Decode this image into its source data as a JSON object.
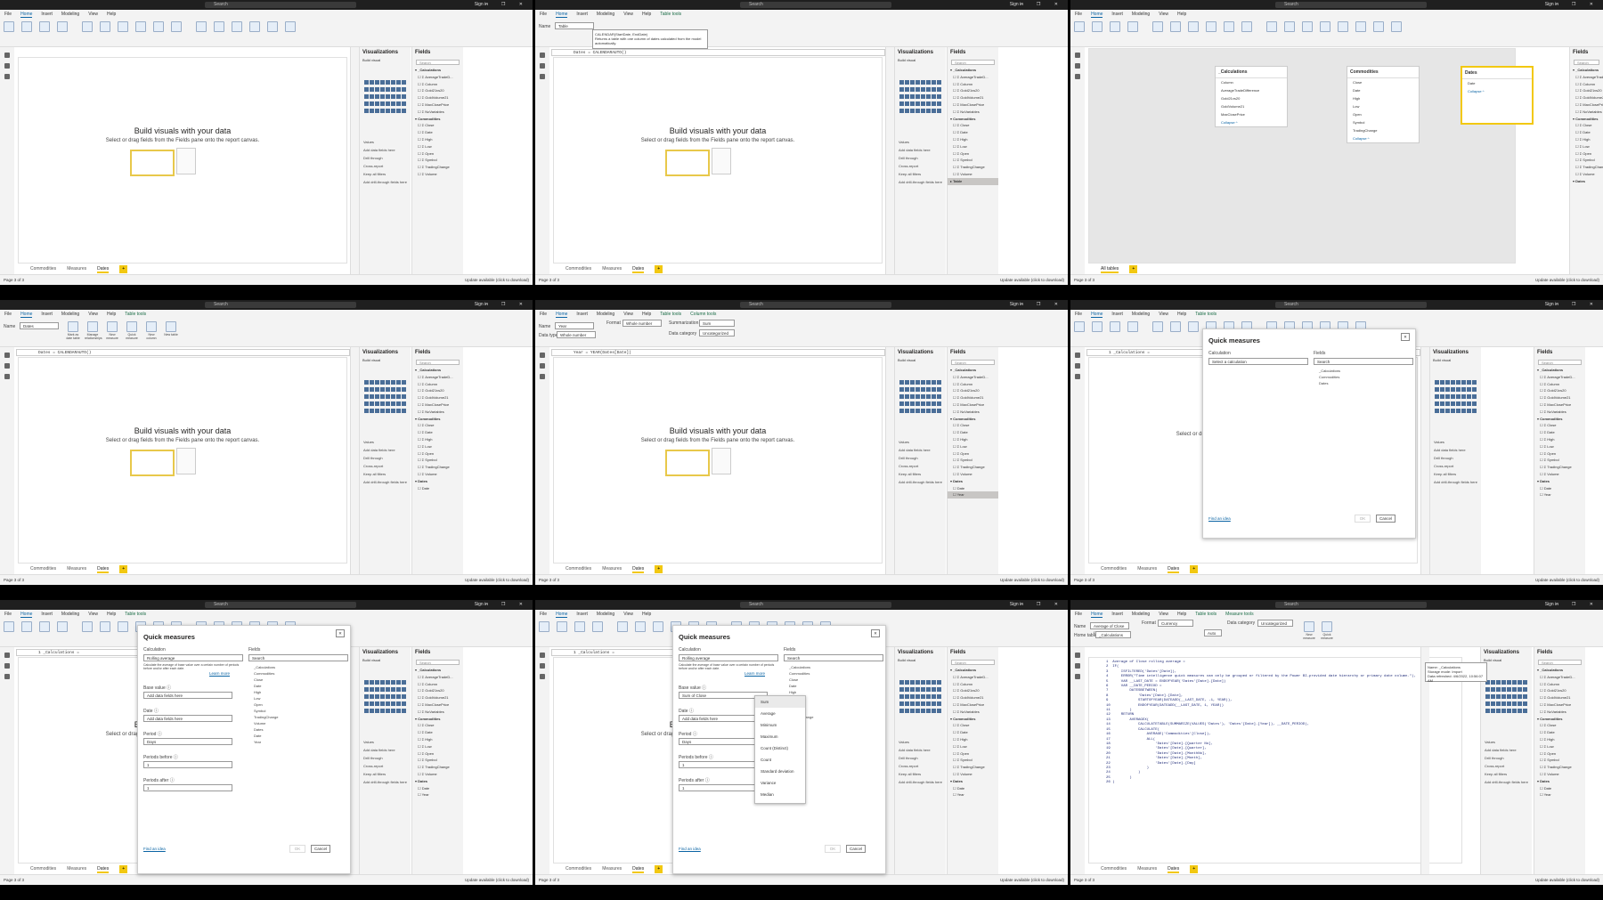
{
  "app": {
    "title": "3_date_and_time - Power BI Desktop",
    "search": "Search",
    "signin": "Sign in",
    "window_buttons": "– ❐ ✕"
  },
  "menus": {
    "base": [
      "File",
      "Home",
      "Insert",
      "Modeling",
      "View",
      "Help"
    ],
    "table_tools": "Table tools",
    "column_tools": "Column tools",
    "measure_tools": "Measure tools"
  },
  "canvas": {
    "title": "Build visuals with your data",
    "subtitle": "Select or drag fields from the Fields pane onto the report canvas."
  },
  "panels": {
    "visualizations": "Visualizations",
    "fields": "Fields",
    "filters": "Filters",
    "build_visual": "Build visual",
    "search": "Search",
    "values": "Values",
    "add_data_fields": "Add data fields here",
    "drill_through": "Drill through",
    "cross_report": "Cross-report",
    "keep_all_filters": "Keep all filters",
    "add_drill": "Add drill-through fields here"
  },
  "fields_list": [
    {
      "name": "_Calculations",
      "table": true
    },
    {
      "name": "AverageTradeD..."
    },
    {
      "name": "Column"
    },
    {
      "name": "Gold21vs20"
    },
    {
      "name": "GoldVolume21"
    },
    {
      "name": "MaxClosePrice"
    },
    {
      "name": "NoVariables"
    },
    {
      "name": "Commodities",
      "table": true
    },
    {
      "name": "Close"
    },
    {
      "name": "Date"
    },
    {
      "name": "High"
    },
    {
      "name": "Low"
    },
    {
      "name": "Open"
    },
    {
      "name": "Symbol"
    },
    {
      "name": "TradingChange"
    },
    {
      "name": "Volume"
    }
  ],
  "pagetabs": [
    "Commodities",
    "Measures",
    "Dates"
  ],
  "status": {
    "page": "Page 3 of 3",
    "update": "Update available (click to download)",
    "all_tables": "All tables"
  },
  "formulas": {
    "dates": "Dates = CALENDARAUTO()",
    "year": "Year = YEAR(Dates[Date])",
    "calculations": "1 _Calculations ="
  },
  "ribbon": {
    "name_label": "Name",
    "name_table": "Table",
    "name_dates": "Dates",
    "name_year": "Year",
    "name_measure": "Average of Close r...",
    "home_table": "Home table",
    "home_table_val": "_Calculations",
    "format": "Format",
    "format_whole": "Whole number",
    "format_currency": "Currency",
    "data_type": "Data type",
    "data_type_val": "Whole number",
    "summarization": "Summarization",
    "summarization_val": "Sum",
    "data_category": "Data category",
    "data_category_val": "Uncategorized",
    "mark_as_date": "Mark as date table",
    "manage_rel": "Manage relationships",
    "new_measure": "New measure",
    "quick_measure": "Quick measure",
    "new_column": "New column",
    "new_table": "New table",
    "sort_by": "Sort by column",
    "data_groups": "Data groups",
    "auto": "Auto"
  },
  "tooltip": {
    "func": "CALENDAR(StartDate, EndDate)",
    "desc": "Returns a table with one column of dates calculated from the model automatically."
  },
  "model_view": {
    "calc_card": {
      "title": "_Calculations",
      "fields": [
        "Column",
        "AverageTradeDifference",
        "Gold21vs20",
        "GoldVolume21",
        "MaxClosePrice"
      ],
      "collapse": "Collapse ^"
    },
    "comm_card": {
      "title": "Commodities",
      "fields": [
        "Close",
        "Date",
        "High",
        "Low",
        "Open",
        "Symbol",
        "TradingChange"
      ],
      "collapse": "Collapse ^"
    },
    "dates_card": {
      "title": "Dates",
      "fields": [
        "Date"
      ],
      "collapse": "Collapse ^"
    }
  },
  "quick_measures": {
    "title": "Quick measures",
    "calculation": "Calculation",
    "select_calc": "Select a calculation",
    "calc_value": "Rolling average",
    "calc_desc": "Calculate the average of base value over a certain number of periods before and/or after each date.",
    "learn_more": "Learn more",
    "fields": "Fields",
    "search": "Search",
    "base_value": "Base value",
    "add_data": "Add data fields here",
    "base_value_sel": "Sum of Close",
    "date": "Date",
    "period": "Period",
    "period_val": "Days",
    "periods_before": "Periods before",
    "periods_before_val": "1",
    "periods_after": "Periods after",
    "periods_after_val": "1",
    "find_idea": "Find an idea",
    "ok": "OK",
    "cancel": "Cancel",
    "tree": [
      "_Calculations",
      "Commodities",
      "Close",
      "Date",
      "High",
      "Low",
      "Open",
      "Symbol",
      "TradingChange",
      "Volume",
      "Dates",
      "Date",
      "Year"
    ],
    "agg_options": [
      "Sum",
      "Average",
      "Minimum",
      "Maximum",
      "Count (Distinct)",
      "Count",
      "Standard deviation",
      "Variance",
      "Median"
    ]
  },
  "dax_code": [
    "1  Average of Close rolling average =",
    "2  IF(",
    "3      ISFILTERED('Dates'[Date]),",
    "4      ERROR(\"Time intelligence quick measures can only be grouped or filtered by the Power BI-provided date hierarchy or primary date column.\"),",
    "5      VAR __LAST_DATE = ENDOFYEAR('Dates'[Date].[Date])",
    "6      VAR __DATE_PERIOD =",
    "7          DATESBETWEEN(",
    "8              'Dates'[Date].[Date],",
    "9              STARTOFYEAR(DATEADD(__LAST_DATE, -1, YEAR)),",
    "10             ENDOFYEAR(DATEADD(__LAST_DATE, 1, YEAR))",
    "11         )",
    "12     RETURN",
    "13         AVERAGEX(",
    "14             CALCULATETABLE(SUMMARIZE(VALUES('Dates'), 'Dates'[Date].[Year]), __DATE_PERIOD),",
    "15             CALCULATE(",
    "16                 AVERAGE('Commodities'[Close]),",
    "17                 ALL(",
    "18                     'Dates'[Date].[Quarter No],",
    "19                     'Dates'[Date].[Quarter],",
    "20                     'Dates'[Date].[MonthNo],",
    "21                     'Dates'[Date].[Month],",
    "22                     'Dates'[Date].[Day]",
    "23                 )",
    "24             )",
    "25         )",
    "26 )"
  ],
  "prop_box": {
    "name": "Name",
    "name_val": "_Calculations",
    "storage": "Storage mode",
    "storage_val": "Import",
    "refreshed": "Data refreshed",
    "refreshed_val": "4/6/2022, 10:56:07 AM"
  }
}
